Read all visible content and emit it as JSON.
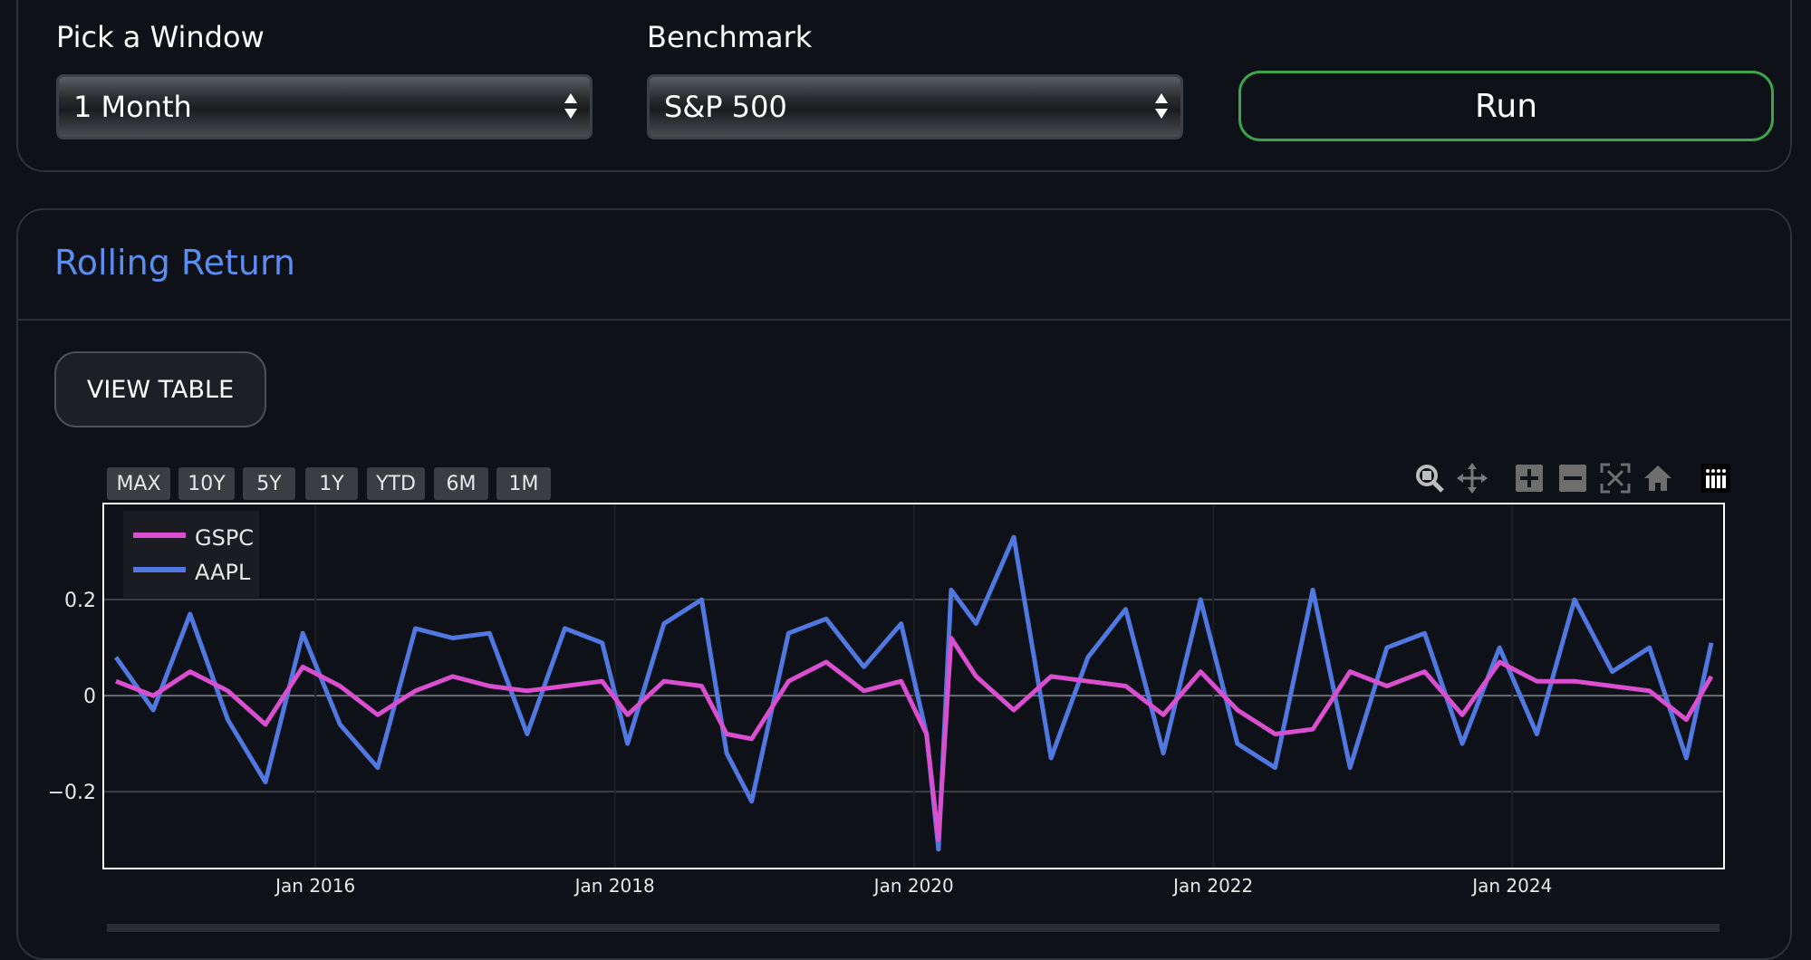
{
  "controls": {
    "window_label": "Pick a Window",
    "window_value": "1 Month",
    "benchmark_label": "Benchmark",
    "benchmark_value": "S&P 500",
    "run_label": "Run"
  },
  "section": {
    "title": "Rolling Return",
    "view_table_label": "VIEW TABLE"
  },
  "range_buttons": [
    "MAX",
    "10Y",
    "5Y",
    "1Y",
    "YTD",
    "6M",
    "1M"
  ],
  "toolbar": [
    "zoom-icon",
    "pan-icon",
    "zoom-in-icon",
    "zoom-out-icon",
    "autoscale-icon",
    "reset-axes-icon",
    "plotly-logo-icon"
  ],
  "colors": {
    "gspc": "#d94fcf",
    "aapl": "#5078e0",
    "accent": "#5b8def",
    "run_border": "#3fa34d"
  },
  "chart_data": {
    "type": "line",
    "legend_placement": "top-left",
    "grid": true,
    "ylim": [
      -0.36,
      0.4
    ],
    "yticks": [
      "0.2",
      "0",
      "−0.2"
    ],
    "ytick_values": [
      0.2,
      0,
      -0.2
    ],
    "xlim": [
      "2014-08-01",
      "2025-06-01"
    ],
    "xticks": [
      "Jan 2016",
      "Jan 2018",
      "Jan 2020",
      "Jan 2022",
      "Jan 2024"
    ],
    "xtick_values": [
      "2016-01-01",
      "2018-01-01",
      "2020-01-01",
      "2022-01-01",
      "2024-01-01"
    ],
    "series": [
      {
        "name": "GSPC",
        "x": [
          "2014-09",
          "2014-12",
          "2015-03",
          "2015-06",
          "2015-09",
          "2015-12",
          "2016-03",
          "2016-06",
          "2016-09",
          "2016-12",
          "2017-03",
          "2017-06",
          "2017-09",
          "2017-12",
          "2018-02",
          "2018-05",
          "2018-08",
          "2018-10",
          "2018-12",
          "2019-03",
          "2019-06",
          "2019-09",
          "2019-12",
          "2020-02",
          "2020-03",
          "2020-04",
          "2020-06",
          "2020-09",
          "2020-12",
          "2021-03",
          "2021-06",
          "2021-09",
          "2021-12",
          "2022-03",
          "2022-06",
          "2022-09",
          "2022-12",
          "2023-03",
          "2023-06",
          "2023-09",
          "2023-12",
          "2024-03",
          "2024-06",
          "2024-09",
          "2024-12",
          "2025-03",
          "2025-05"
        ],
        "y": [
          0.03,
          0.0,
          0.05,
          0.01,
          -0.06,
          0.06,
          0.02,
          -0.04,
          0.01,
          0.04,
          0.02,
          0.01,
          0.02,
          0.03,
          -0.04,
          0.03,
          0.02,
          -0.08,
          -0.09,
          0.03,
          0.07,
          0.01,
          0.03,
          -0.08,
          -0.3,
          0.12,
          0.04,
          -0.03,
          0.04,
          0.03,
          0.02,
          -0.04,
          0.05,
          -0.03,
          -0.08,
          -0.07,
          0.05,
          0.02,
          0.05,
          -0.04,
          0.07,
          0.03,
          0.03,
          0.02,
          0.01,
          -0.05,
          0.04
        ]
      },
      {
        "name": "AAPL",
        "x": [
          "2014-09",
          "2014-12",
          "2015-03",
          "2015-06",
          "2015-09",
          "2015-12",
          "2016-03",
          "2016-06",
          "2016-09",
          "2016-12",
          "2017-03",
          "2017-06",
          "2017-09",
          "2017-12",
          "2018-02",
          "2018-05",
          "2018-08",
          "2018-10",
          "2018-12",
          "2019-03",
          "2019-06",
          "2019-09",
          "2019-12",
          "2020-02",
          "2020-03",
          "2020-04",
          "2020-06",
          "2020-09",
          "2020-12",
          "2021-03",
          "2021-06",
          "2021-09",
          "2021-12",
          "2022-03",
          "2022-06",
          "2022-09",
          "2022-12",
          "2023-03",
          "2023-06",
          "2023-09",
          "2023-12",
          "2024-03",
          "2024-06",
          "2024-09",
          "2024-12",
          "2025-03",
          "2025-05"
        ],
        "y": [
          0.08,
          -0.03,
          0.17,
          -0.05,
          -0.18,
          0.13,
          -0.06,
          -0.15,
          0.14,
          0.12,
          0.13,
          -0.08,
          0.14,
          0.11,
          -0.1,
          0.15,
          0.2,
          -0.12,
          -0.22,
          0.13,
          0.16,
          0.06,
          0.15,
          -0.08,
          -0.32,
          0.22,
          0.15,
          0.33,
          -0.13,
          0.08,
          0.18,
          -0.12,
          0.2,
          -0.1,
          -0.15,
          0.22,
          -0.15,
          0.1,
          0.13,
          -0.1,
          0.1,
          -0.08,
          0.2,
          0.05,
          0.1,
          -0.13,
          0.11
        ]
      }
    ]
  }
}
